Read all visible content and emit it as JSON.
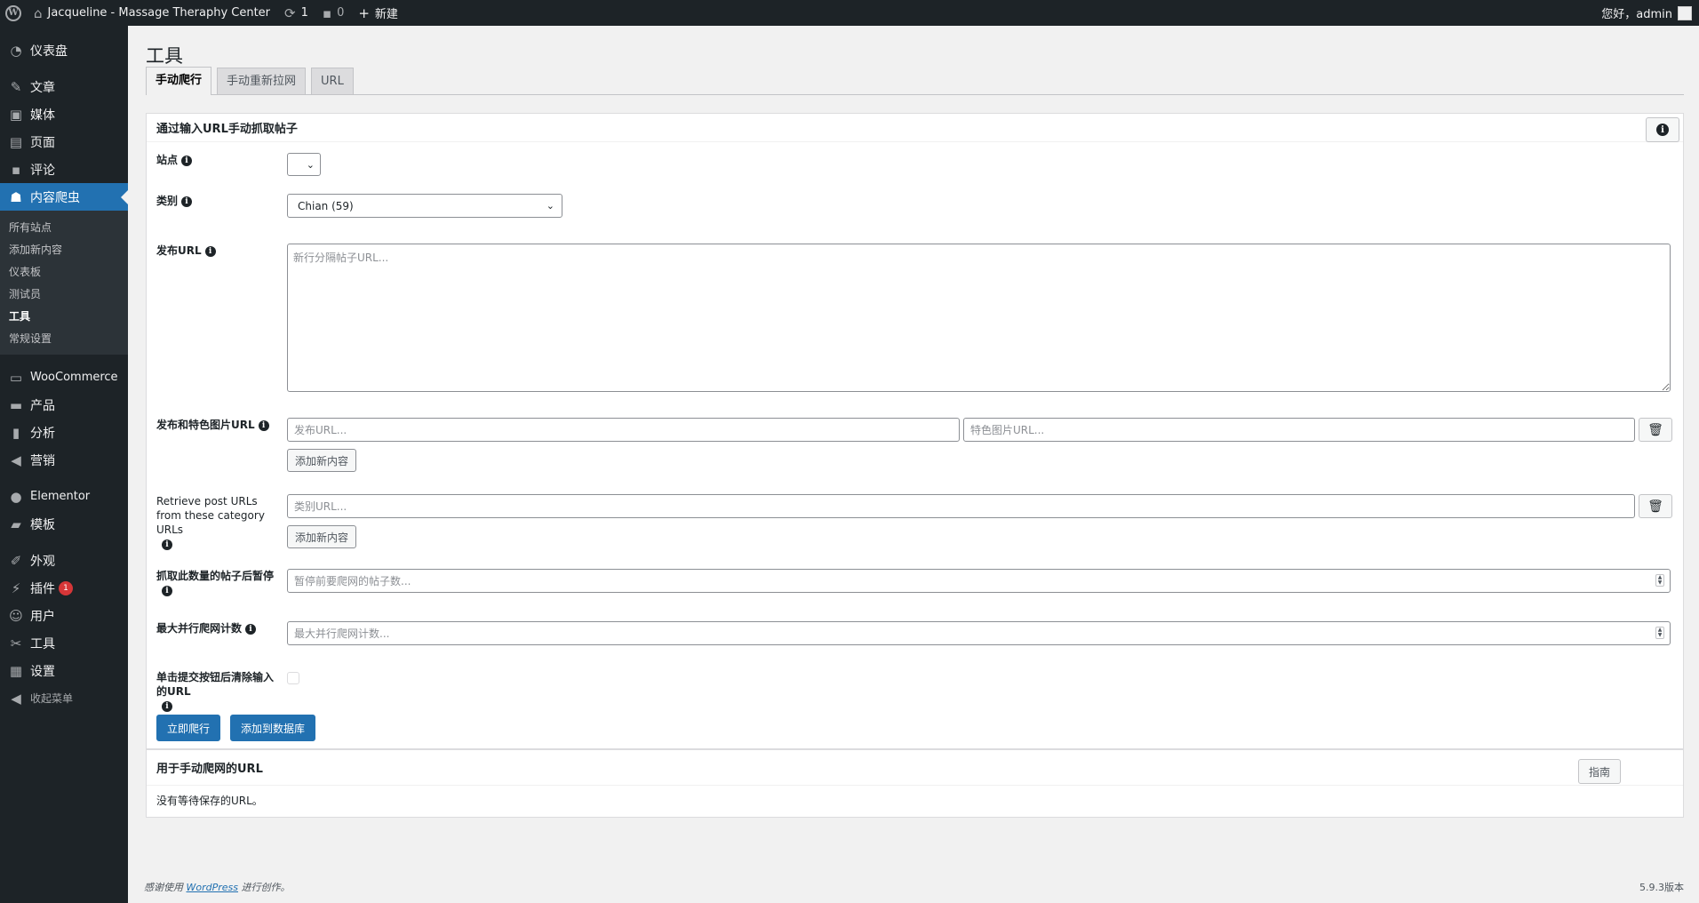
{
  "adminbar": {
    "site_name": "Jacqueline - Massage Theraphy Center",
    "updates_count": "1",
    "comments_count": "0",
    "new_label": "新建",
    "greeting": "您好，admin"
  },
  "sidebar": {
    "items": [
      {
        "label": "仪表盘",
        "icon": "dashboard-icon"
      },
      {
        "label": "文章",
        "icon": "pin-icon"
      },
      {
        "label": "媒体",
        "icon": "media-icon"
      },
      {
        "label": "页面",
        "icon": "page-icon"
      },
      {
        "label": "评论",
        "icon": "comment-icon"
      },
      {
        "label": "内容爬虫",
        "icon": "crawler-icon"
      }
    ],
    "submenu": [
      "所有站点",
      "添加新内容",
      "仪表板",
      "测试员",
      "工具",
      "常规设置"
    ],
    "items2": [
      {
        "label": "WooCommerce",
        "icon": "woo-icon"
      },
      {
        "label": "产品",
        "icon": "archive-icon"
      },
      {
        "label": "分析",
        "icon": "chart-icon"
      },
      {
        "label": "营销",
        "icon": "megaphone-icon"
      }
    ],
    "items3": [
      {
        "label": "Elementor",
        "icon": "elementor-icon"
      },
      {
        "label": "模板",
        "icon": "folder-icon"
      }
    ],
    "items4": [
      {
        "label": "外观",
        "icon": "brush-icon"
      },
      {
        "label": "插件",
        "icon": "plugin-icon",
        "badge": "1"
      },
      {
        "label": "用户",
        "icon": "user-icon"
      },
      {
        "label": "工具",
        "icon": "wrench-icon"
      },
      {
        "label": "设置",
        "icon": "settings-icon"
      }
    ],
    "collapse_label": "收起菜单"
  },
  "page": {
    "title": "工具",
    "tabs": [
      "手动爬行",
      "手动重新拉网",
      "URL"
    ]
  },
  "manual_box": {
    "title": "通过输入URL手动抓取帖子",
    "site_label": "站点",
    "category_label": "类别",
    "category_value": "Chian (59)",
    "post_urls_label": "发布URL",
    "post_urls_placeholder": "新行分隔帖子URL...",
    "featured_label": "发布和特色图片URL",
    "post_url_placeholder": "发布URL...",
    "featured_url_placeholder": "特色图片URL...",
    "add_new_label": "添加新内容",
    "category_urls_label": "Retrieve post URLs from these category URLs",
    "category_url_placeholder": "类别URL...",
    "pause_label": "抓取此数量的帖子后暂停",
    "pause_placeholder": "暂停前要爬网的帖子数...",
    "max_label": "最大并行爬网计数",
    "max_placeholder": "最大并行爬网计数...",
    "clear_label": "单击提交按钮后清除输入的URL",
    "crawl_now": "立即爬行",
    "add_db": "添加到数据库"
  },
  "urls_box": {
    "title": "用于手动爬网的URL",
    "guide": "指南",
    "empty": "没有等待保存的URL。"
  },
  "footer": {
    "thanks_prefix": "感谢使用",
    "wordpress": "WordPress",
    "thanks_suffix": "进行创作。",
    "version": "5.9.3版本"
  }
}
